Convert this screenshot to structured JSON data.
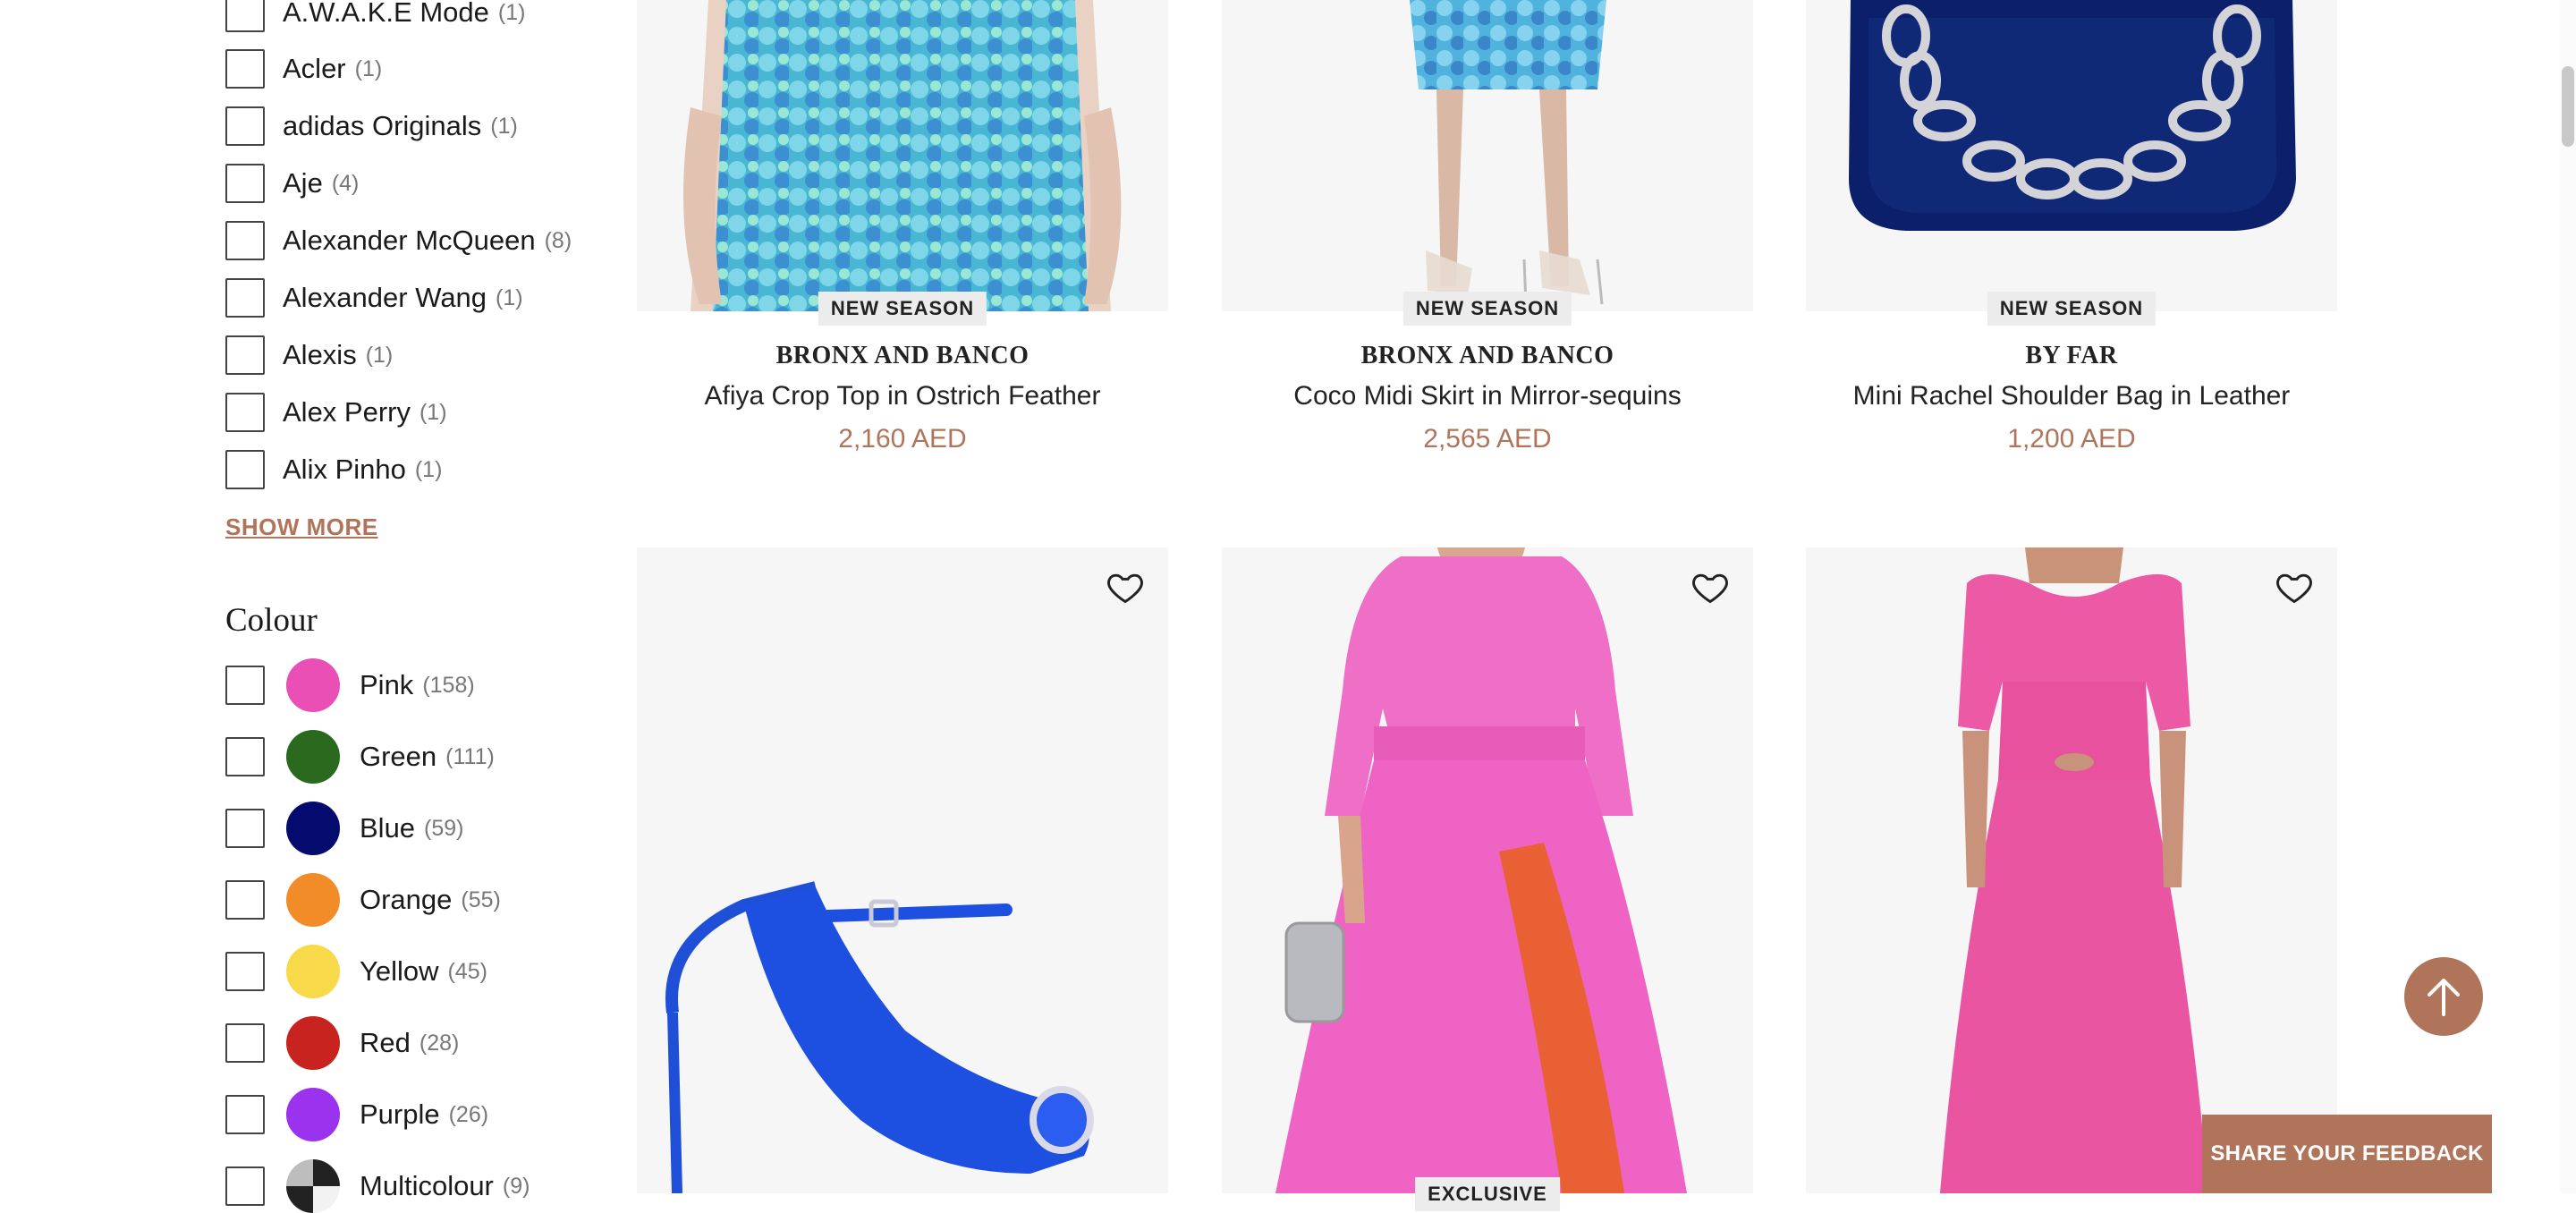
{
  "filters": {
    "brands": [
      {
        "label": "A.W.A.K.E Mode",
        "count": "(1)"
      },
      {
        "label": "Acler",
        "count": "(1)"
      },
      {
        "label": "adidas Originals",
        "count": "(1)"
      },
      {
        "label": "Aje",
        "count": "(4)"
      },
      {
        "label": "Alexander McQueen",
        "count": "(8)"
      },
      {
        "label": "Alexander Wang",
        "count": "(1)"
      },
      {
        "label": "Alexis",
        "count": "(1)"
      },
      {
        "label": "Alex Perry",
        "count": "(1)"
      },
      {
        "label": "Alix Pinho",
        "count": "(1)"
      }
    ],
    "show_more_label": "SHOW MORE",
    "colour_heading": "Colour",
    "colours": [
      {
        "label": "Pink",
        "count": "(158)",
        "hex": "#e94fb4"
      },
      {
        "label": "Green",
        "count": "(111)",
        "hex": "#2b6a1e"
      },
      {
        "label": "Blue",
        "count": "(59)",
        "hex": "#050a6e"
      },
      {
        "label": "Orange",
        "count": "(55)",
        "hex": "#f28c28"
      },
      {
        "label": "Yellow",
        "count": "(45)",
        "hex": "#f7d94a"
      },
      {
        "label": "Red",
        "count": "(28)",
        "hex": "#c8241f"
      },
      {
        "label": "Purple",
        "count": "(26)",
        "hex": "#9b32ee"
      },
      {
        "label": "Multicolour",
        "count": "(9)",
        "hex": "multi"
      }
    ]
  },
  "products_row1": [
    {
      "badge": "NEW SEASON",
      "brand": "BRONX AND BANCO",
      "name": "Afiya Crop Top in Ostrich Feather",
      "price": "2,160 AED"
    },
    {
      "badge": "NEW SEASON",
      "brand": "BRONX AND BANCO",
      "name": "Coco Midi Skirt in Mirror-sequins",
      "price": "2,565 AED"
    },
    {
      "badge": "NEW SEASON",
      "brand": "BY FAR",
      "name": "Mini Rachel Shoulder Bag in Leather",
      "price": "1,200 AED"
    }
  ],
  "products_row2": [
    {
      "badge": ""
    },
    {
      "badge": "EXCLUSIVE"
    },
    {
      "badge": ""
    }
  ],
  "ui": {
    "feedback_label": "SHARE YOUR FEEDBACK",
    "back_to_top_icon": "arrow-up-icon",
    "heart_icon": "heart-outline-icon",
    "accent": "#b0745a"
  }
}
